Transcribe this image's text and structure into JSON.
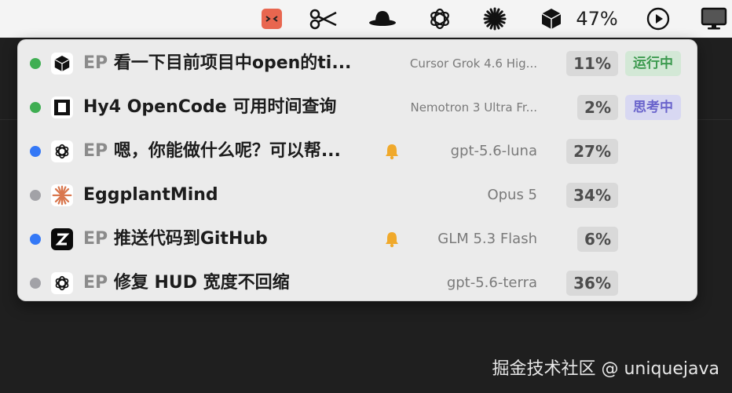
{
  "menubar": {
    "icons": [
      "app-face-icon",
      "scissors-icon",
      "hat-icon",
      "openai-icon",
      "asterisk-icon",
      "cube-icon",
      "play-icon",
      "display-icon"
    ],
    "battery_percent": "47%"
  },
  "hud": {
    "rows": [
      {
        "dot_color": "#3fae52",
        "icon": "cube-icon",
        "prefix": "EP",
        "title": "看一下目前项目中open的ti...",
        "bell": false,
        "model": "Cursor Grok 4.6 Hig...",
        "model_small": true,
        "percent": "11%",
        "status": "运行中",
        "status_kind": "running"
      },
      {
        "dot_color": "#3fae52",
        "icon": "opencode-icon",
        "prefix": "",
        "title": "Hy4 OpenCode 可用时间查询",
        "bell": false,
        "model": "Nemotron 3 Ultra Fr...",
        "model_small": true,
        "percent": "2%",
        "status": "思考中",
        "status_kind": "thinking"
      },
      {
        "dot_color": "#3478f6",
        "icon": "openai-icon",
        "prefix": "EP",
        "title": "嗯，你能做什么呢？可以帮...",
        "bell": true,
        "model": "gpt-5.6-luna",
        "model_small": false,
        "percent": "27%",
        "status": "",
        "status_kind": ""
      },
      {
        "dot_color": "#a2a2a7",
        "icon": "claude-icon",
        "prefix": "",
        "title": "EggplantMind",
        "bell": false,
        "model": "Opus 5",
        "model_small": false,
        "percent": "34%",
        "status": "",
        "status_kind": ""
      },
      {
        "dot_color": "#3478f6",
        "icon": "zhipu-icon",
        "prefix": "EP",
        "title": "推送代码到GitHub",
        "bell": true,
        "model": "GLM 5.3 Flash",
        "model_small": false,
        "percent": "6%",
        "status": "",
        "status_kind": ""
      },
      {
        "dot_color": "#a2a2a7",
        "icon": "openai-icon",
        "prefix": "EP",
        "title": "修复 HUD 宽度不回缩",
        "bell": false,
        "model": "gpt-5.6-terra",
        "model_small": false,
        "percent": "36%",
        "status": "",
        "status_kind": ""
      }
    ]
  },
  "watermark": "掘金技术社区 @ uniquejava",
  "colors": {
    "running": "#3c9a4f",
    "thinking": "#6a64cc",
    "bell": "#f0a92b"
  }
}
